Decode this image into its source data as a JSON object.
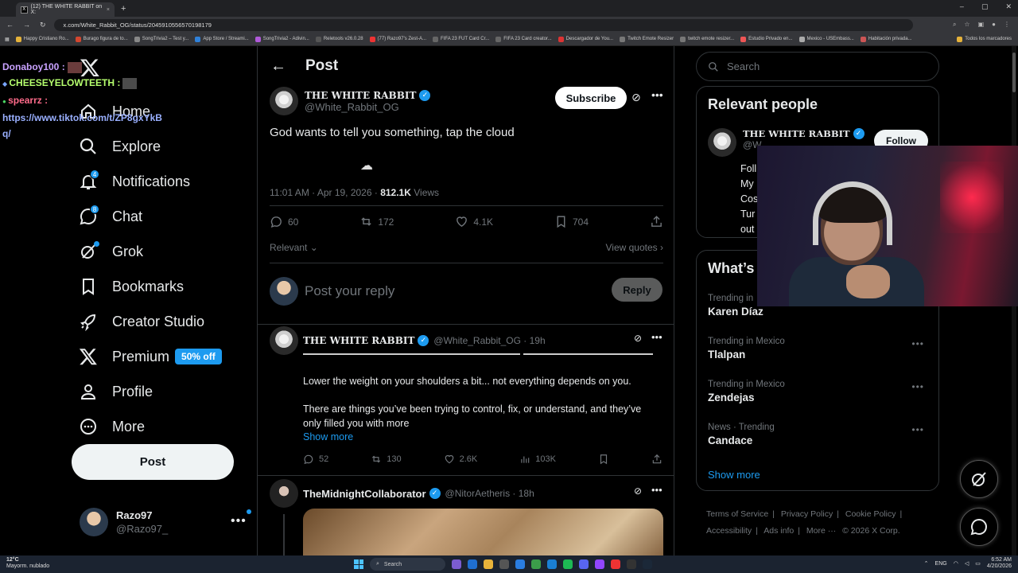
{
  "browser": {
    "tab_title": "(12) THE WHITE RABBIT on X:",
    "url": "x.com/White_Rabbit_OG/status/2045910556570198179",
    "bookmarks": [
      "Happy Cristiano Ro...",
      "Burago figura de to...",
      "SongTrivia2 – Test y...",
      "App Store / Streami...",
      "SongTrivia2 - Adivin...",
      "Reletools v26.0.28",
      "(77) Razo97's Zest-A...",
      "FIFA 23 FUT Card Cr...",
      "FIFA 23 Card creator...",
      "Descargador de You...",
      "Twitch Emote Resizer",
      "twitch emote resizer...",
      "Estudio Privado en...",
      "Mexico - USEmbass...",
      "Habitación privada..."
    ],
    "all_bookmarks": "Todos los marcadores"
  },
  "overlay_chat": {
    "line1_user": "Donaboy100 :",
    "line2_user": "CHEESEYELOWTEETH :",
    "line3_user": "spearrz :",
    "line3_link": "https://www.tiktok.com/t/ZP8gxYkB",
    "line3_link_cont": "q/"
  },
  "nav": {
    "items": [
      {
        "label": "Home"
      },
      {
        "label": "Explore"
      },
      {
        "label": "Notifications",
        "badge": "4"
      },
      {
        "label": "Chat",
        "badge": "8"
      },
      {
        "label": "Grok"
      },
      {
        "label": "Bookmarks"
      },
      {
        "label": "Creator Studio"
      },
      {
        "label": "Premium",
        "pill": "50% off"
      },
      {
        "label": "Profile"
      },
      {
        "label": "More"
      }
    ],
    "post_button": "Post",
    "account_name": "Razo97",
    "account_handle": "@Razo97_"
  },
  "header": {
    "title": "Post"
  },
  "main_post": {
    "author_name": "THE WHITE RABBIT",
    "author_handle": "@White_Rabbit_OG",
    "subscribe_label": "Subscribe",
    "text": "God wants to tell you something, tap the cloud",
    "time": "11:01 AM · Apr 19, 2026 · ",
    "views_count": "812.1K",
    "views_label": " Views",
    "replies": "60",
    "reposts": "172",
    "likes": "4.1K",
    "bookmarks": "704",
    "sort_label": "Relevant",
    "view_quotes": "View quotes"
  },
  "reply_box": {
    "placeholder": "Post your reply",
    "button": "Reply"
  },
  "reply1": {
    "author_name": "THE WHITE RABBIT",
    "author_handle": "@White_Rabbit_OG · 19h",
    "para1": "Lower the weight on your shoulders a bit... not everything depends on you.",
    "para2": "There are things you’ve been trying to control, fix, or understand, and they’ve only filled you with more",
    "show_more": "Show more",
    "replies": "52",
    "reposts": "130",
    "likes": "2.6K",
    "views": "103K"
  },
  "reply2": {
    "author_name": "TheMidnightCollaborator",
    "author_handle": "@NitorAetheris · 18h"
  },
  "right": {
    "search_placeholder": "Search",
    "relevant_people_title": "Relevant people",
    "person_name": "THE WHITE RABBIT",
    "person_handle": "@W",
    "follow_label": "Follow",
    "bio_lines": [
      "Foll",
      "My",
      "Cos",
      "Tur",
      "out"
    ],
    "whats_title": "What’s",
    "trends": [
      {
        "context": "Trending in",
        "name": "Karen Díaz"
      },
      {
        "context": "Trending in Mexico",
        "name": "Tlalpan"
      },
      {
        "context": "Trending in Mexico",
        "name": "Zendejas"
      },
      {
        "context": "News · Trending",
        "name": "Candace"
      }
    ],
    "show_more": "Show more",
    "footer_links": [
      "Terms of Service",
      "|",
      "Privacy Policy",
      "|",
      "Cookie Policy",
      "|",
      "Accessibility",
      "|",
      "Ads info",
      "|",
      "More ···",
      "© 2026 X Corp."
    ]
  },
  "taskbar": {
    "temp": "12°C",
    "weather": "Mayorm. nublado",
    "search": "Search",
    "lang": "ENG",
    "time": "6:52 AM",
    "date": "4/20/2026"
  }
}
